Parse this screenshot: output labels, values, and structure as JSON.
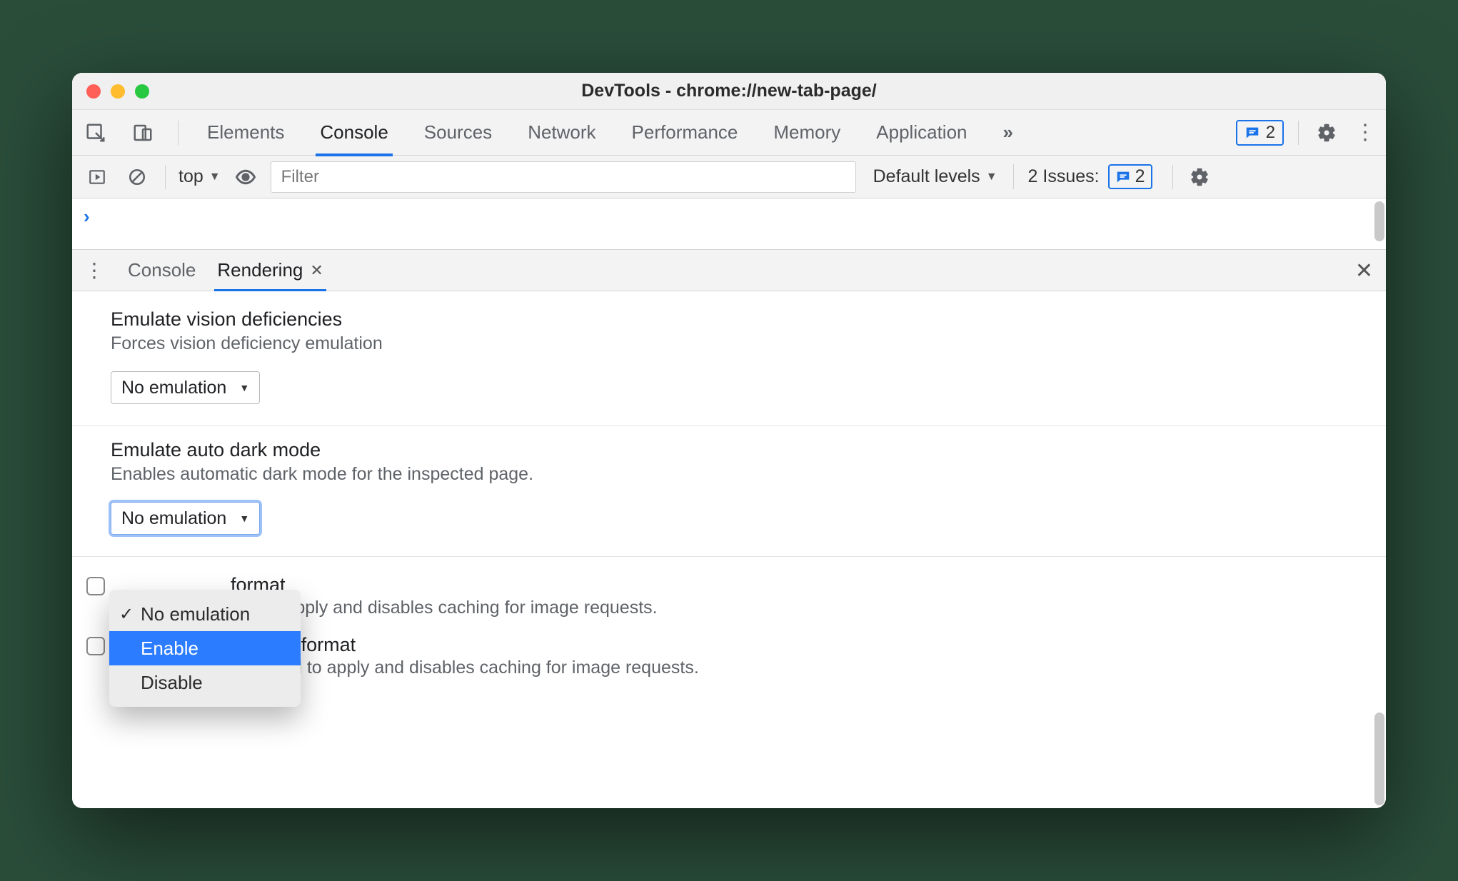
{
  "window": {
    "title": "DevTools - chrome://new-tab-page/"
  },
  "tabs": {
    "items": [
      "Elements",
      "Console",
      "Sources",
      "Network",
      "Performance",
      "Memory",
      "Application"
    ],
    "active": "Console",
    "overflow_glyph": "»",
    "badge_count": "2"
  },
  "console_toolbar": {
    "context": "top",
    "filter_placeholder": "Filter",
    "levels_label": "Default levels",
    "issues_label": "2 Issues:",
    "issues_count": "2"
  },
  "drawer": {
    "tabs": [
      "Console",
      "Rendering"
    ],
    "active": "Rendering"
  },
  "rendering": {
    "vision": {
      "title": "Emulate vision deficiencies",
      "subtitle": "Forces vision deficiency emulation",
      "value": "No emulation"
    },
    "darkmode": {
      "title": "Emulate auto dark mode",
      "subtitle": "Enables automatic dark mode for the inspected page.",
      "value": "No emulation",
      "options": [
        "No emulation",
        "Enable",
        "Disable"
      ],
      "highlighted": "Enable"
    },
    "avif": {
      "title_visible_fragment": "format",
      "subtitle_visible_fragment": "oad to apply and disables caching for image requests."
    },
    "webp": {
      "title": "Disable WebP image format",
      "subtitle": "Requires a page reload to apply and disables caching for image requests."
    }
  }
}
